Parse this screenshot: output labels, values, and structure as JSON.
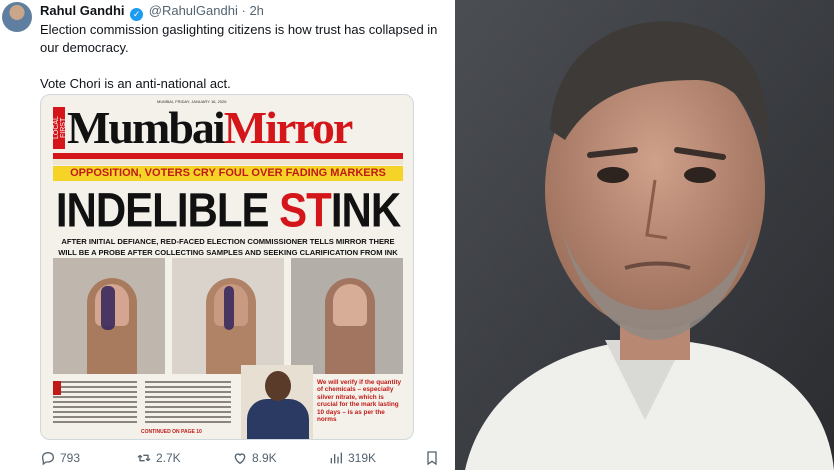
{
  "tweet": {
    "author_name": "Rahul Gandhi",
    "verified_glyph": "✓",
    "handle": "@RahulGandhi",
    "separator": "·",
    "time": "2h",
    "paragraphs": [
      "Election commission gaslighting citizens is how trust has collapsed in our democracy.",
      "Vote Chori is an anti-national act."
    ]
  },
  "newspaper": {
    "masthead_1": "Mumbai",
    "masthead_2": "Mirror",
    "local_tag": "LOCAL FIRST",
    "dateline": "MUMBAI, FRIDAY, JANUARY 16, 2026",
    "kicker": "OPPOSITION, VOTERS CRY FOUL OVER FADING MARKERS",
    "headline_1": "INDELIBLE ",
    "headline_2": "ST",
    "headline_3": "INK",
    "deck": "AFTER INITIAL DEFIANCE, RED-FACED ELECTION COMMISSIONER TELLS MIRROR THERE WILL BE A PROBE AFTER COLLECTING SAMPLES AND SEEKING CLARIFICATION FROM INK SUPPLIER KORES",
    "pull_quote": "We will verify if the quantity of chemicals – especially silver nitrate, which is crucial for the mark lasting 10 days – is as per the norms",
    "continued": "CONTINUED ON PAGE 10"
  },
  "actions": {
    "replies": "793",
    "reposts": "2.7K",
    "likes": "8.9K",
    "views": "319K"
  },
  "icons": [
    "verified-badge-icon",
    "reply-icon",
    "repost-icon",
    "like-icon",
    "views-icon",
    "bookmark-icon"
  ],
  "colors": {
    "accent": "#1d9bf0",
    "masthead_red": "#d4161b",
    "kicker_yellow": "#f6d327"
  }
}
